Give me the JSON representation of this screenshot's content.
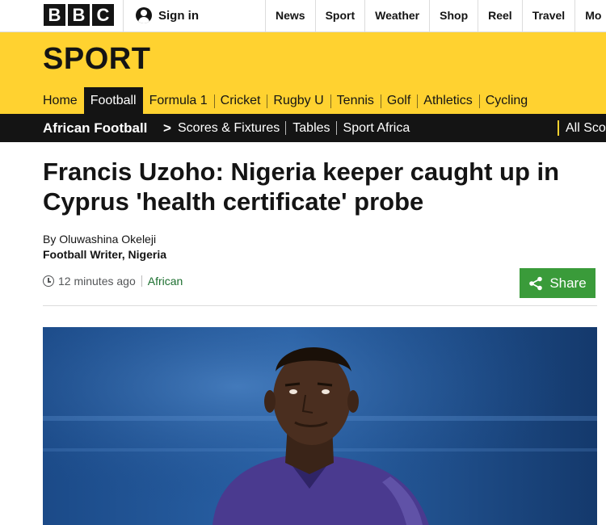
{
  "global_nav": {
    "logo": [
      "B",
      "B",
      "C"
    ],
    "signin_label": "Sign in",
    "items": [
      "News",
      "Sport",
      "Weather",
      "Shop",
      "Reel",
      "Travel",
      "Mo"
    ]
  },
  "sport": {
    "title": "SPORT",
    "nav": [
      {
        "label": "Home",
        "active": false
      },
      {
        "label": "Football",
        "active": true
      },
      {
        "label": "Formula 1",
        "active": false
      },
      {
        "label": "Cricket",
        "active": false
      },
      {
        "label": "Rugby U",
        "active": false
      },
      {
        "label": "Tennis",
        "active": false
      },
      {
        "label": "Golf",
        "active": false
      },
      {
        "label": "Athletics",
        "active": false
      },
      {
        "label": "Cycling",
        "active": false
      }
    ]
  },
  "secondary_nav": {
    "section": "African Football",
    "chevron": ">",
    "items": [
      "Scores & Fixtures",
      "Tables",
      "Sport Africa"
    ],
    "all_sports": "All Sco"
  },
  "article": {
    "headline": "Francis Uzoho: Nigeria keeper caught up in Cyprus 'health certificate' probe",
    "byline": "By Oluwashina Okeleji",
    "role": "Football Writer, Nigeria",
    "time": "12 minutes ago",
    "topic": "African",
    "share_label": "Share"
  },
  "colors": {
    "sport_yellow": "#ffd230",
    "share_green": "#3a9b3a",
    "topic_green": "#1b6e2e",
    "nav_black": "#141414"
  },
  "icons": {
    "user": "user-icon",
    "clock": "clock-icon",
    "share": "share-icon"
  }
}
